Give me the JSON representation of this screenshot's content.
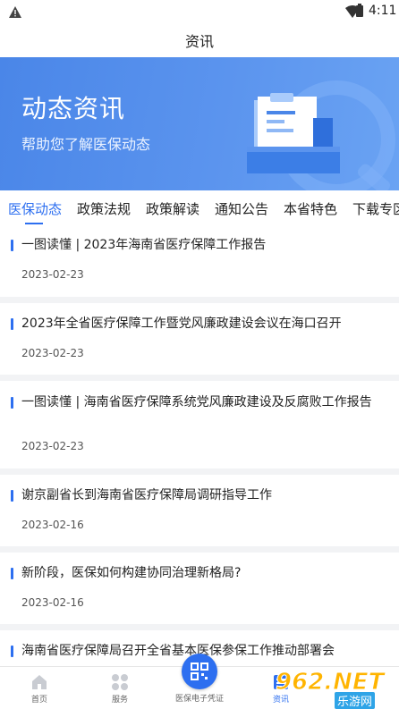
{
  "status_bar": {
    "time": "4:11"
  },
  "header": {
    "title": "资讯"
  },
  "banner": {
    "title": "动态资讯",
    "subtitle": "帮助您了解医保动态"
  },
  "tabs": [
    {
      "label": "医保动态",
      "active": true
    },
    {
      "label": "政策法规"
    },
    {
      "label": "政策解读"
    },
    {
      "label": "通知公告"
    },
    {
      "label": "本省特色"
    },
    {
      "label": "下载专区"
    }
  ],
  "articles": [
    {
      "title": "一图读懂 | 2023年海南省医疗保障工作报告",
      "date": "2023-02-23"
    },
    {
      "title": "2023年全省医疗保障工作暨党风廉政建设会议在海口召开",
      "date": "2023-02-23"
    },
    {
      "title": "一图读懂 | 海南省医疗保障系统党风廉政建设及反腐败工作报告",
      "date": "2023-02-23"
    },
    {
      "title": "谢京副省长到海南省医疗保障局调研指导工作",
      "date": "2023-02-16"
    },
    {
      "title": "新阶段，医保如何构建协同治理新格局?",
      "date": "2023-02-16"
    },
    {
      "title": "海南省医疗保障局召开全省基本医保参保工作推动部署会",
      "date": ""
    }
  ],
  "bottom_nav": {
    "home": "首页",
    "services": "服务",
    "qr": "医保电子凭证",
    "news": "资讯"
  },
  "watermark": {
    "number": "962.NET",
    "text": "乐游网"
  },
  "colors": {
    "accent": "#2d6ff0",
    "banner": "#5b94ee"
  }
}
